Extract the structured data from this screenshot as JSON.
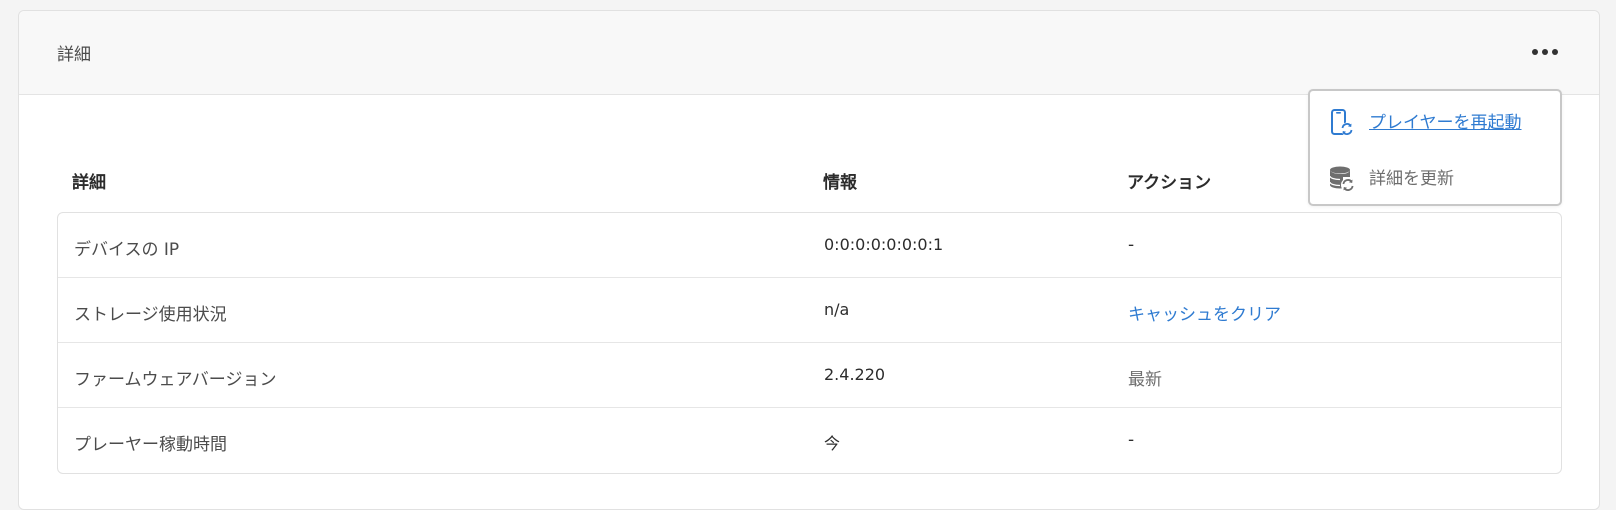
{
  "panel": {
    "title": "詳細"
  },
  "menu": {
    "items": [
      {
        "label": "プレイヤーを再起動",
        "icon": "device-refresh-icon",
        "color": "#2f7bd1"
      },
      {
        "label": "詳細を更新",
        "icon": "database-refresh-icon",
        "color": "#6e6e6e"
      }
    ]
  },
  "table": {
    "headers": [
      "詳細",
      "情報",
      "アクション"
    ],
    "rows": [
      {
        "detail": "デバイスの IP",
        "info": "0:0:0:0:0:0:0:1",
        "action": "-"
      },
      {
        "detail": "ストレージ使用状況",
        "info": "n/a",
        "action": "キャッシュをクリア"
      },
      {
        "detail": "ファームウェアバージョン",
        "info": "2.4.220",
        "action": "最新"
      },
      {
        "detail": "プレーヤー稼動時間",
        "info": "今",
        "action": "-"
      }
    ]
  },
  "colors": {
    "accent": "#2f7bd1",
    "muted": "#6e6e6e",
    "background": "#f4f4f4"
  }
}
